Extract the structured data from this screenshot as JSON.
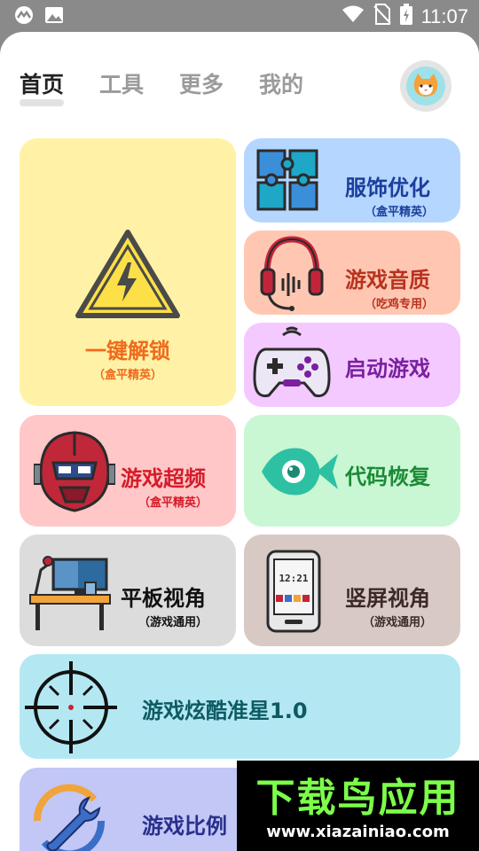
{
  "status_bar": {
    "time": "11:07"
  },
  "tabs": [
    {
      "label": "首页",
      "active": true
    },
    {
      "label": "工具",
      "active": false
    },
    {
      "label": "更多",
      "active": false
    },
    {
      "label": "我的",
      "active": false
    }
  ],
  "cards": {
    "unlock": {
      "title": "一键解锁",
      "subtitle": "（盒平精英）",
      "color": "#fff2a6",
      "text_color": "#f06a1c",
      "icon": "warning-icon"
    },
    "clothing": {
      "title": "服饰优化",
      "subtitle": "（盒平精英）",
      "color": "#b5d6ff",
      "text_color": "#1c3f9e",
      "icon": "puzzle-icon"
    },
    "audio": {
      "title": "游戏音质",
      "subtitle": "（吃鸡专用）",
      "color": "#ffc7b2",
      "text_color": "#b8321e",
      "icon": "headphones-icon"
    },
    "launch": {
      "title": "启动游戏",
      "color": "#f3c9ff",
      "text_color": "#7a1fa0",
      "icon": "gamepad-icon"
    },
    "overclock": {
      "title": "游戏超频",
      "subtitle": "（盒平精英）",
      "color": "#ffc7c7",
      "text_color": "#d41c2a",
      "icon": "robot-mask-icon"
    },
    "restore": {
      "title": "代码恢复",
      "color": "#c9f7d3",
      "text_color": "#1b8a35",
      "icon": "fish-icon"
    },
    "tablet": {
      "title": "平板视角",
      "subtitle": "（游戏通用）",
      "color": "#dcdcdc",
      "text_color": "#111111",
      "icon": "desk-icon"
    },
    "portrait": {
      "title": "竖屏视角",
      "subtitle": "（游戏通用）",
      "color": "#d9c9c5",
      "text_color": "#3b2a26",
      "icon": "phone-icon",
      "phone_time": "12:21"
    },
    "crosshair": {
      "title": "游戏炫酷准星1.0",
      "color": "#b3e8f3",
      "text_color": "#0e5a63",
      "icon": "crosshair-icon"
    },
    "ratio": {
      "title": "游戏比例",
      "color": "#c2c7f6",
      "text_color": "#2a2f8c",
      "icon": "wrench-icon"
    }
  },
  "watermark": {
    "logo": "下载鸟应用",
    "url": "www.xiazainiao.com"
  }
}
